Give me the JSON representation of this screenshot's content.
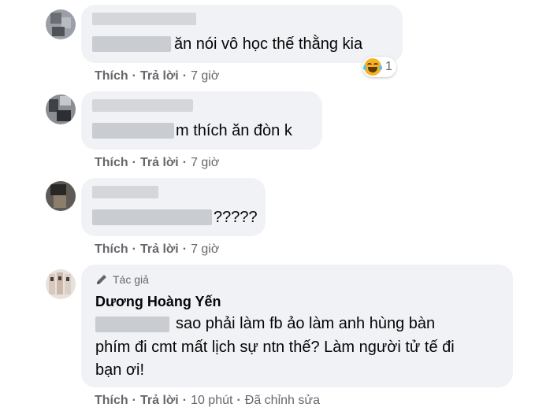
{
  "comments": [
    {
      "text": "ăn nói vô học thế thằng kia",
      "reaction_count": "1",
      "like": "Thích",
      "reply": "Trả lời",
      "time": "7 giờ"
    },
    {
      "text": "m thích ăn đòn k",
      "like": "Thích",
      "reply": "Trả lời",
      "time": "7 giờ"
    },
    {
      "text": "?????",
      "like": "Thích",
      "reply": "Trả lời",
      "time": "7 giờ"
    },
    {
      "badge": "Tác giả",
      "author": "Dương Hoàng Yến",
      "line1": "sao phải làm fb ảo làm anh hùng bàn",
      "line2": "phím đi cmt mất lịch sự ntn thế? Làm người tử tế đi",
      "line3": "bạn ơi!",
      "like": "Thích",
      "reply": "Trả lời",
      "time": "10 phút",
      "edited": "Đã chỉnh sửa"
    }
  ],
  "icons": {
    "reaction": "haha-emoji-icon",
    "badge": "pencil-icon"
  },
  "colors": {
    "bubble": "#f0f2f5",
    "meta": "#65676b",
    "text": "#050505",
    "haha": "#f7b125"
  }
}
